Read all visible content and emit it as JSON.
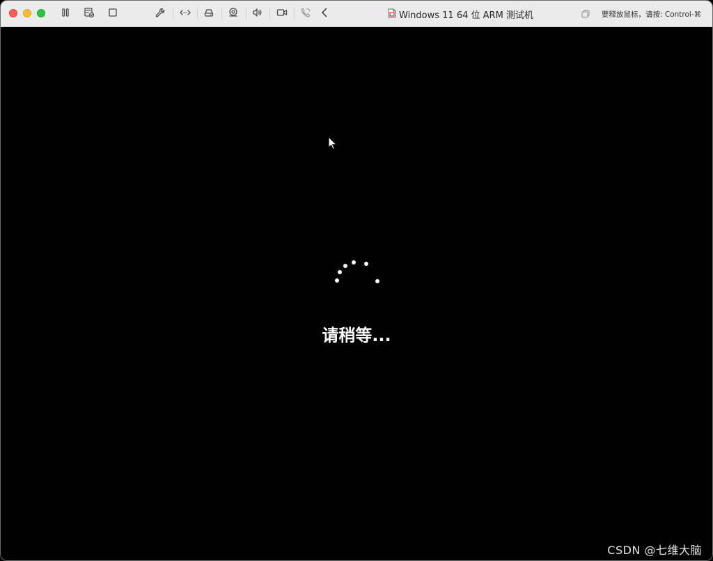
{
  "window": {
    "title": "Windows 11 64 位 ARM 测试机",
    "release_hint": "要释放鼠标，请按: Control-⌘"
  },
  "toolbar": {
    "icons": [
      "pause-icon",
      "snapshot-icon",
      "stop-icon",
      "settings-wrench-icon",
      "network-icon",
      "disk-icon",
      "usb-icon",
      "sound-icon",
      "camera-icon",
      "phone-icon",
      "collapse-chevron-icon"
    ]
  },
  "guest_screen": {
    "status_text": "请稍等..."
  },
  "watermark": "CSDN @七维大脑",
  "colors": {
    "titlebar": "#ebebeb",
    "close": "#fe5f57",
    "minimize": "#febc2e",
    "zoom": "#28c840",
    "screen_bg": "#000000",
    "text_on_screen": "#ffffff"
  }
}
